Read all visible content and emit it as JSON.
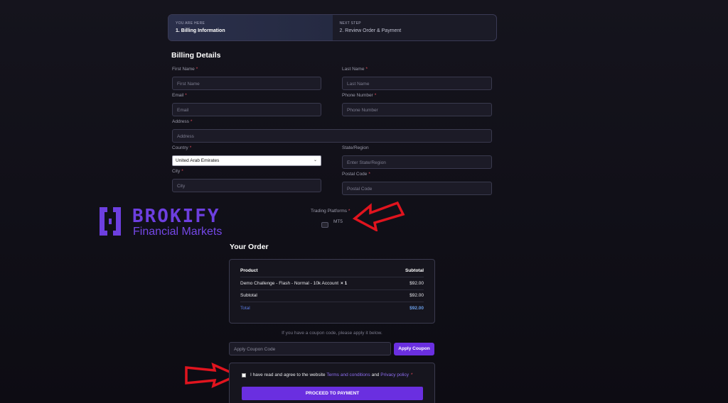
{
  "steps": {
    "current_caption": "YOU ARE HERE",
    "current_label": "1. Billing Information",
    "next_caption": "NEXT STEP",
    "next_label": "2. Review Order & Payment"
  },
  "billing": {
    "title": "Billing Details",
    "first_name": {
      "label": "First Name",
      "placeholder": "First Name"
    },
    "last_name": {
      "label": "Last Name",
      "placeholder": "Last Name"
    },
    "email": {
      "label": "Email",
      "placeholder": "Email"
    },
    "phone": {
      "label": "Phone Number",
      "placeholder": "Phone Number"
    },
    "address": {
      "label": "Address",
      "placeholder": "Address"
    },
    "country": {
      "label": "Country",
      "value": "United Arab Emirates"
    },
    "state": {
      "label": "State/Region",
      "placeholder": "Enter State/Region"
    },
    "city": {
      "label": "City",
      "placeholder": "City"
    },
    "postal": {
      "label": "Postal Code",
      "placeholder": "Postal Code"
    },
    "required_mark": "*"
  },
  "logo": {
    "brand": "BROKIFY",
    "sub": "Financial Markets",
    "color": "#6d3fe0"
  },
  "trading": {
    "label": "Trading Platforms",
    "option": "MT5"
  },
  "order": {
    "title": "Your Order",
    "head_product": "Product",
    "head_subtotal": "Subtotal",
    "item_name": "Demo Challenge - Flash - Normal - 10k Account",
    "item_qty": "× 1",
    "item_price": "$92.00",
    "subtotal_label": "Subtotal",
    "subtotal_value": "$92.00",
    "total_label": "Total",
    "total_value": "$92.00"
  },
  "coupon": {
    "note": "If you have a coupon code, please apply it below.",
    "placeholder": "Apply Coupon Code",
    "button": "Apply Coupon"
  },
  "agreement": {
    "text_before": "I have read and agree to the website",
    "terms": "Terms and conditions",
    "and": "and",
    "privacy": "Privacy policy",
    "button": "PROCEED TO PAYMENT"
  },
  "colors": {
    "accent": "#6a2fe0",
    "arrow": "#e0141e"
  }
}
